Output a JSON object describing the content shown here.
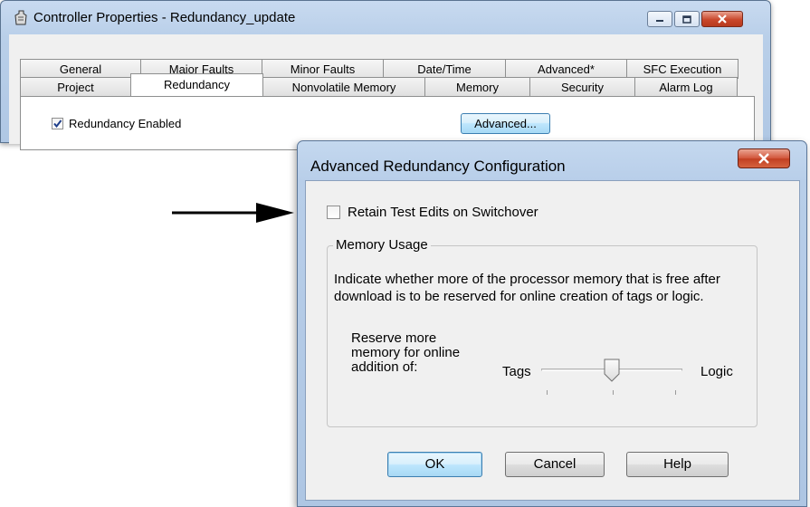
{
  "controller_window": {
    "title": "Controller Properties - Redundancy_update",
    "tabs_row1": [
      "General",
      "Major Faults",
      "Minor Faults",
      "Date/Time",
      "Advanced*",
      "SFC Execution"
    ],
    "tabs_row2": [
      "Project",
      "Redundancy",
      "Nonvolatile Memory",
      "Memory",
      "Security",
      "Alarm Log"
    ],
    "active_tab": "Redundancy",
    "redundancy_enabled_label": "Redundancy Enabled",
    "redundancy_enabled_checked": true,
    "advanced_button_label": "Advanced..."
  },
  "dialog": {
    "title": "Advanced Redundancy Configuration",
    "close_glyph": "x",
    "retain_label": "Retain Test Edits on Switchover",
    "retain_checked": false,
    "memory_group": {
      "legend": "Memory Usage",
      "description": "Indicate whether more of the processor memory that is free after download is to be reserved for online creation of tags or logic.",
      "reserve_label": "Reserve more memory for online addition of:",
      "left_label": "Tags",
      "right_label": "Logic",
      "slider_position": 0.5
    },
    "buttons": {
      "ok": "OK",
      "cancel": "Cancel",
      "help": "Help"
    }
  }
}
